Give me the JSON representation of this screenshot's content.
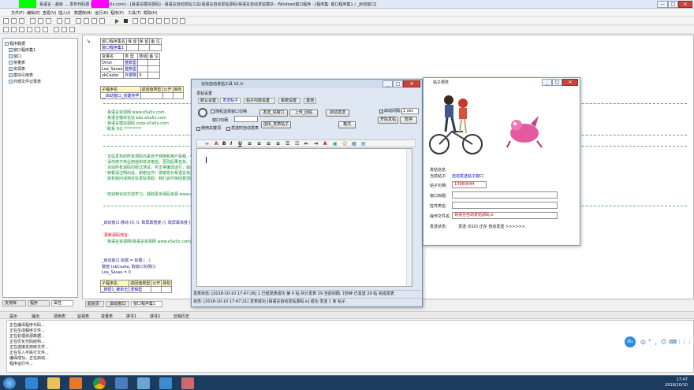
{
  "main_window": {
    "title": "易语言 - 超级 … 发布代码源 (www.e5a5x.com) - [易语言模块源码] - 易语言自动发帖工具/易语言自动发帖源码/易语言自动发帖模块 - Windows窗口程序 - [程序集: 窗口程序集1 / _启动窗口]",
    "menu": [
      "文件(F)",
      "编辑(E)",
      "查看(V)",
      "插入(I)",
      "数据库(B)",
      "运行(R)",
      "程序(P)",
      "工具(T)",
      "帮助(H)"
    ],
    "controls": {
      "minimize": "—",
      "maximize": "□",
      "close": "✕"
    }
  },
  "tree": {
    "items": [
      {
        "label": "程序数据",
        "level": 0
      },
      {
        "label": "窗口程序集1",
        "level": 1
      },
      {
        "label": "窗口",
        "level": 1
      },
      {
        "label": "常量表",
        "level": 1
      },
      {
        "label": "资源表",
        "level": 1
      },
      {
        "label": "模块引用表",
        "level": 1
      },
      {
        "label": "外部文件记录表",
        "level": 1
      }
    ],
    "tabs": [
      "支持库",
      "程序",
      "属性"
    ]
  },
  "editor": {
    "table1": {
      "headers": [
        "窗口程序集名",
        "保 留",
        "保 留",
        "备 注"
      ],
      "rows": [
        [
          "窗口程序集1",
          "",
          "",
          ""
        ]
      ]
    },
    "table2": {
      "headers": [
        "变量名",
        "类 型",
        "数组",
        "备 注"
      ],
      "rows": [
        [
          "Dmsl",
          "整数型",
          "",
          ""
        ],
        [
          "Loa_Sasaa",
          "整数型",
          "",
          ""
        ],
        [
          "xbCazke",
          "外部数",
          "0",
          ""
        ]
      ]
    },
    "table3": {
      "headers": [
        "子程序名",
        "返回值类型",
        "公开",
        "易包"
      ],
      "rows": [
        [
          "__启动窗口_创建完毕",
          "",
          "",
          ""
        ]
      ]
    },
    "lines_a": [
      "' 易语言资源网       www.e5a5x.com",
      "' 易语言模块论坛     bbs.e5a5x.com",
      "' 易语言模块源码     code.e5a5x.com",
      "' 联系 QQ        *********"
    ],
    "lines_b": [
      "' 本站发布的所有源码均来自于网络和用户投稿，仅供学习和研究使用，",
      "' 请勿用于商业用途和非法用途，否则后果自负。本站资源如有侵权请联系我们删除，",
      "' 本站所有源码均经过测试，可正常编译运行，如出现问题请到论坛反馈。",
      "' 转载请注明出处，谢谢合作！感谢您对易语言资源网的支持！",
      "' 如有疑问请到论坛发帖求助，我们会尽快回复您的问题。"
    ],
    "line_promo": "' 欢迎到论坛交流学习，获取更多源码资源   www.e5a5x.com",
    "line_call": "_启动窗口.移动 (0, 0, 取屏幕宽度 (), 取屏幕高度 ())",
    "comment_head": "' 更新源码地址：",
    "comment_link": "' 易语言资源网(易语言资源网 www.e5a5x.com)",
    "line_title": "_启动窗口.标题 = 标题 (  ,  )",
    "line_assign1": "赋值 (xbCazke, 取窗口句柄())",
    "line_assign2": "Loa_Sasaa = 0",
    "table4": {
      "headers": [
        "子程序名",
        "返回值类型",
        "公开",
        "易包"
      ],
      "rows": [
        [
          "_按钮1_被单击",
          "逻辑型",
          "",
          ""
        ]
      ]
    },
    "tabs": [
      "起始页",
      "_启动窗口",
      "窗口程序集1"
    ]
  },
  "output": {
    "tabs": [
      "提示",
      "输出",
      "调用表",
      "监视表",
      "变量表",
      "搜寻1",
      "搜寻2",
      "剪辑历史"
    ],
    "lines": [
      "正在编译程序代码...",
      "正在生成程序文件...",
      "正在处理资源数据...",
      "正在优化代码结构...",
      "正在连接支持库文件...",
      "正在写入可执行文件...",
      "编译成功，正在启动...",
      "程序运行中..."
    ]
  },
  "dialog": {
    "title": "论坛自动发帖工具 V1.0",
    "menu_label": "发帖设置",
    "tabs": [
      "默认设置",
      "发送帖子",
      "帖子内容设置",
      "系统设置",
      "其他"
    ],
    "checkbox_follow": "随机选择窗口句柄",
    "window_handle_label": "窗口句柄",
    "btn_send_post": "发送_帖窗口",
    "btn_upload": "上传_回帖",
    "btn_auto": "启动发送",
    "checkbox_interval": "启动间隔:",
    "interval_value": "1 sec",
    "btn_start": "开始发帖",
    "btn_stop": "暂停",
    "btn_format": "格式",
    "btn_select": "选择_发表帖子",
    "checkbox_replace": "使用关键词",
    "checkbox_auto": "发送时自动发表",
    "status1": "发表状态: [2018-10-10 17:47:26]  1.已经发表成功  第 0 帖   共计发表 29   当前间隔: 1秒钟  已发送 29 帖  完成发表",
    "status2": "状态: [2018-10-10 17:47:21]  发表成功 [易语言自动发帖源码.e] 成功 发送 1 条 帖子"
  },
  "preview": {
    "title": "帖子预览",
    "section": "发帖信息",
    "rows": [
      {
        "label": "当前帖子:",
        "value": "自动发送帖子窗口"
      },
      {
        "label": "帖子句柄:",
        "value": "13960044"
      },
      {
        "label": "窗口标题:",
        "value": ""
      },
      {
        "label": "控件类名:",
        "value": ""
      },
      {
        "label": "操作文件名:",
        "value": "易语言自动发帖源码.e"
      }
    ],
    "send_label": "发送状态:",
    "send_status": "发送 (010) 正在 自动发送 >>>>>>"
  },
  "ime": {
    "logo": "du",
    "items": [
      "中",
      "°",
      "，",
      "☺",
      "⌨",
      "⋮",
      "⋮⋮"
    ]
  },
  "taskbar": {
    "time": "17:47",
    "date": "2018/10/10"
  },
  "colors": {
    "green_marker": "#00ff00",
    "magenta_marker": "#ff00ff",
    "link": "#0000cc",
    "red_text": "#d00000"
  }
}
